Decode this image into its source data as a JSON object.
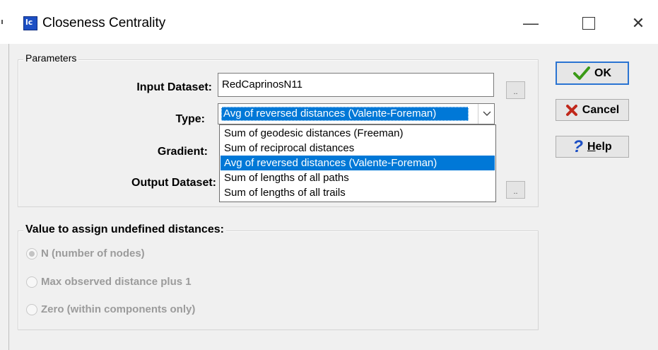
{
  "window": {
    "title": "Closeness Centrality",
    "icon_letters": "lc",
    "controls": {
      "minimize": "—",
      "close": "✕"
    }
  },
  "parameters": {
    "legend": "Parameters",
    "input_dataset_label": "Input Dataset:",
    "input_dataset_value": "RedCaprinosN11",
    "type_label": "Type:",
    "type_selected": "Avg of reversed distances (Valente-Foreman)",
    "gradient_label": "Gradient:",
    "output_dataset_label": "Output Dataset:",
    "browse_label": "..",
    "type_options": [
      "Sum of geodesic distances (Freeman)",
      "Sum of reciprocal distances",
      "Avg of reversed distances (Valente-Foreman)",
      "Sum of lengths of all paths",
      "Sum of lengths of all trails"
    ]
  },
  "undefined_distances": {
    "legend": "Value to assign undefined distances:",
    "options": [
      {
        "label": "N (number of nodes)",
        "selected": true
      },
      {
        "label": "Max observed distance plus 1",
        "selected": false
      },
      {
        "label": "Zero (within components only)",
        "selected": false
      }
    ]
  },
  "buttons": {
    "ok": "OK",
    "cancel": "Cancel",
    "help_first": "H",
    "help_rest": "elp"
  },
  "colors": {
    "selection": "#0078d7",
    "ok_check": "#3a9a16",
    "cancel_x": "#c0281b",
    "help_q": "#1c4fc4"
  }
}
